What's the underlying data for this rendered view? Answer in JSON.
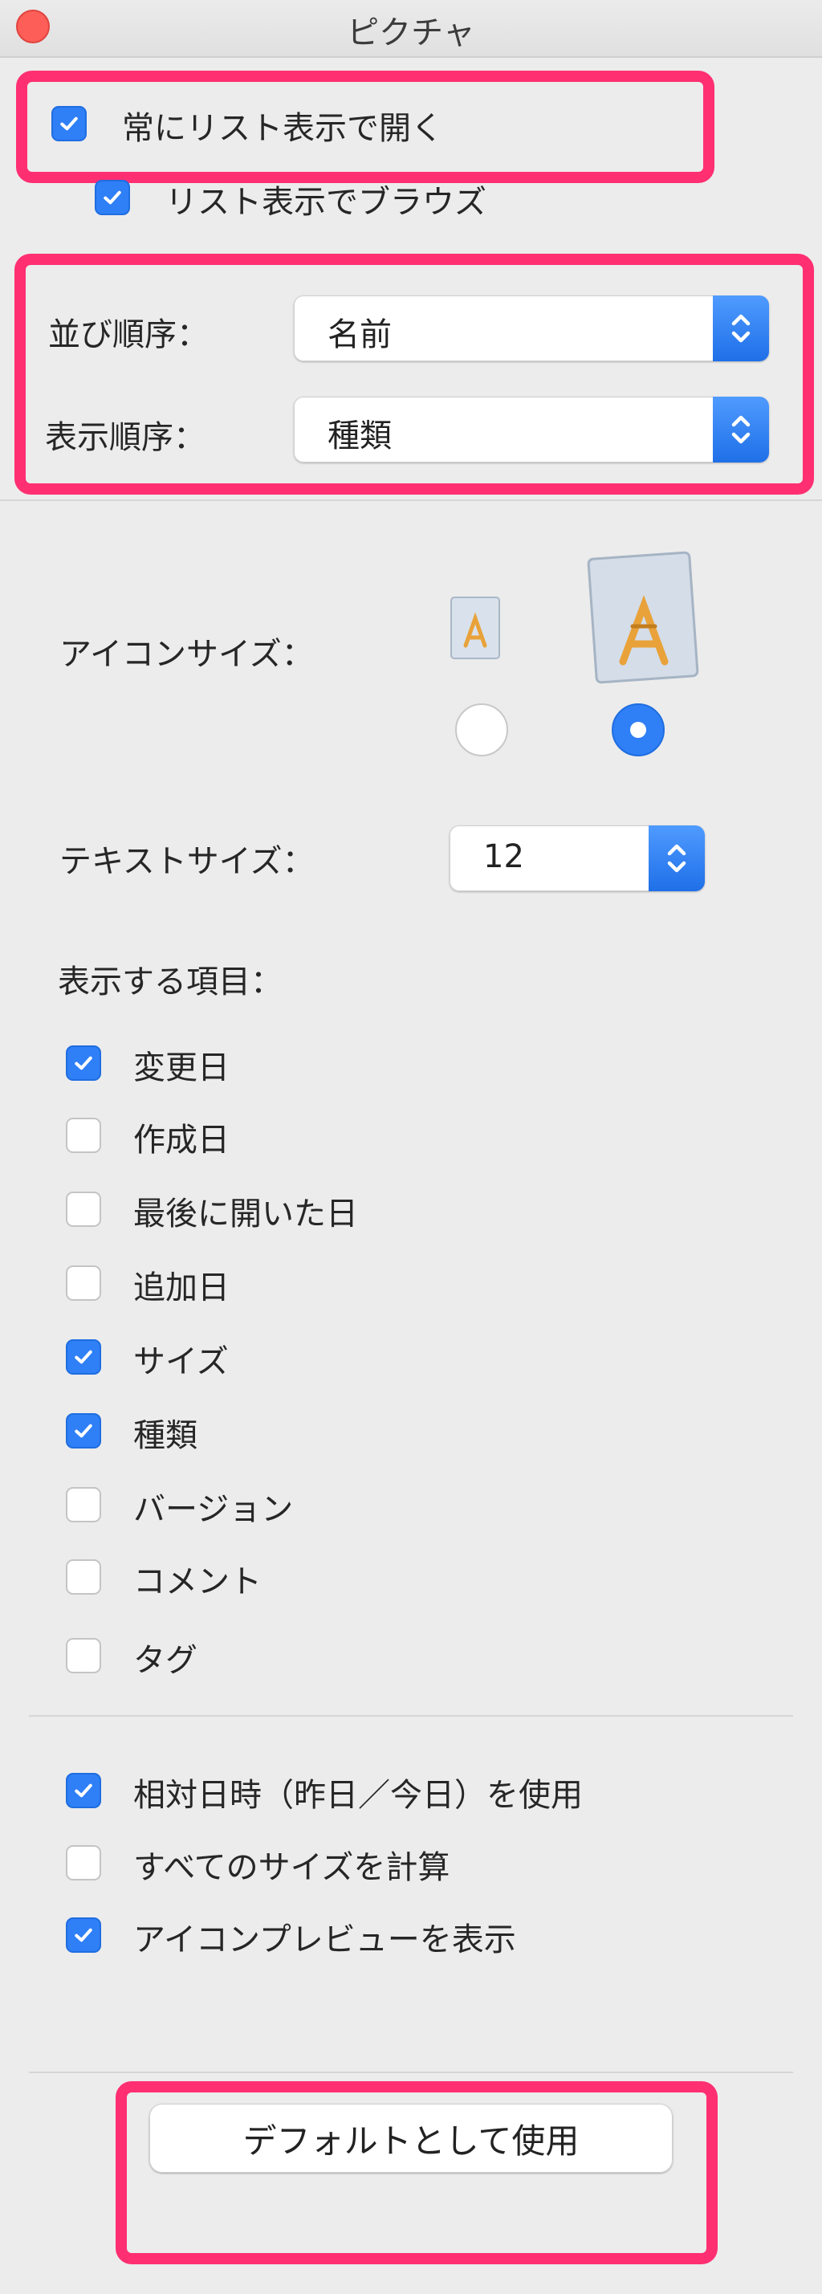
{
  "window": {
    "title": "ピクチャ"
  },
  "header_options": [
    {
      "label": "常にリスト表示で開く",
      "checked": true
    },
    {
      "label": "リスト表示でブラウズ",
      "checked": true
    }
  ],
  "sort": {
    "sort_by_label": "並び順序：",
    "sort_by_value": "名前",
    "group_by_label": "表示順序：",
    "group_by_value": "種類"
  },
  "icon_size": {
    "label": "アイコンサイズ：",
    "selected": "large"
  },
  "text_size": {
    "label": "テキストサイズ：",
    "value": "12"
  },
  "columns": {
    "label": "表示する項目：",
    "items": [
      {
        "label": "変更日",
        "checked": true
      },
      {
        "label": "作成日",
        "checked": false
      },
      {
        "label": "最後に開いた日",
        "checked": false
      },
      {
        "label": "追加日",
        "checked": false
      },
      {
        "label": "サイズ",
        "checked": true
      },
      {
        "label": "種類",
        "checked": true
      },
      {
        "label": "バージョン",
        "checked": false
      },
      {
        "label": "コメント",
        "checked": false
      },
      {
        "label": "タグ",
        "checked": false
      }
    ]
  },
  "other_options": [
    {
      "label": "相対日時（昨日／今日）を使用",
      "checked": true
    },
    {
      "label": "すべてのサイズを計算",
      "checked": false
    },
    {
      "label": "アイコンプレビューを表示",
      "checked": true
    }
  ],
  "use_as_defaults_button": "デフォルトとして使用",
  "colors": {
    "accent": "#2f7ff7",
    "highlight": "#ff2f72",
    "close": "#fd5e57"
  },
  "icons": {
    "check": "checkmark-icon",
    "popup": "chevron-updown-icon",
    "app": "applications-folder-icon"
  }
}
